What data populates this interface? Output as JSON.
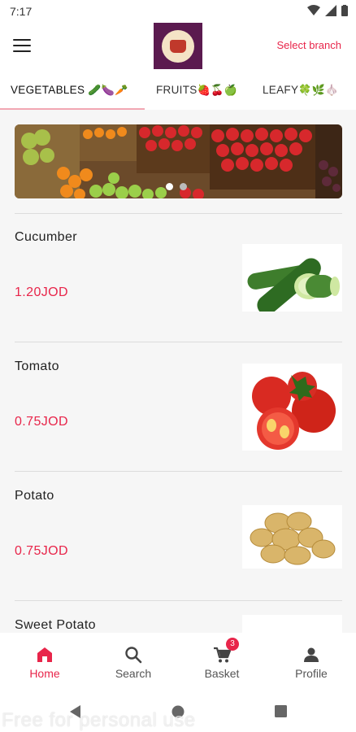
{
  "status_bar": {
    "time": "7:17"
  },
  "header": {
    "branch_link": "Select branch",
    "brand_color": "#5b1a4f",
    "accent_color": "#e8254a"
  },
  "tabs": [
    {
      "label": "VEGETABLES",
      "emoji": "🥒🍆🥕",
      "active": true
    },
    {
      "label": "FRUITS",
      "emoji": "🍓🍒🍏",
      "active": false
    },
    {
      "label": "LEAFY",
      "emoji": "🍀🌿🧄",
      "active": false
    }
  ],
  "banner": {
    "slides": 2,
    "active_slide": 1
  },
  "products": [
    {
      "name": "Cucumber",
      "price": "1.20JOD",
      "icon": "cucumber-image"
    },
    {
      "name": "Tomato",
      "price": "0.75JOD",
      "icon": "tomato-image"
    },
    {
      "name": "Potato",
      "price": "0.75JOD",
      "icon": "potato-image"
    },
    {
      "name": "Sweet Potato",
      "price": "",
      "icon": "sweet-potato-image"
    }
  ],
  "bottom_nav": [
    {
      "label": "Home",
      "icon": "home-icon",
      "active": true
    },
    {
      "label": "Search",
      "icon": "search-icon",
      "active": false
    },
    {
      "label": "Basket",
      "icon": "basket-icon",
      "active": false,
      "badge": "3"
    },
    {
      "label": "Profile",
      "icon": "profile-icon",
      "active": false
    }
  ],
  "watermark": "Free for personal use"
}
